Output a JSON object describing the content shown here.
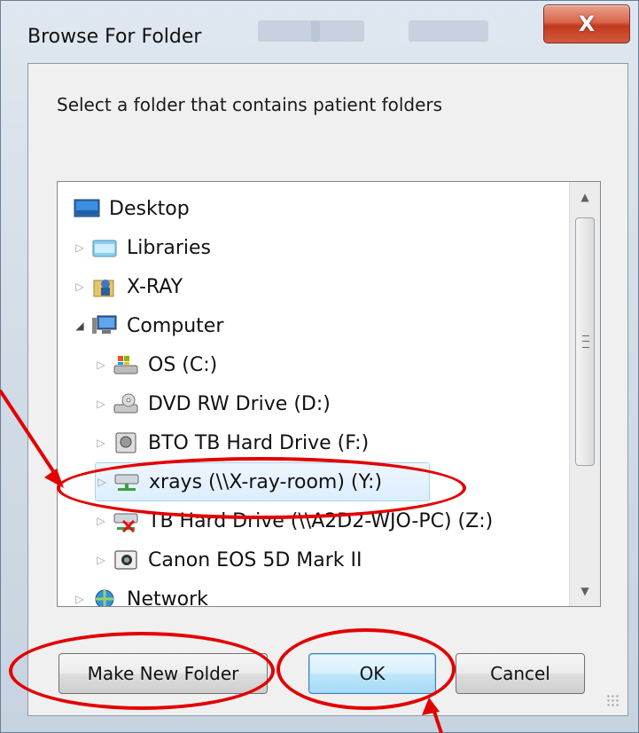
{
  "window": {
    "title": "Browse For Folder",
    "close_glyph": "X"
  },
  "prompt": "Select a folder that contains patient folders",
  "tree": {
    "items": [
      {
        "label": "Desktop",
        "icon": "desktop-icon",
        "expander": ""
      },
      {
        "label": "Libraries",
        "icon": "libraries-icon",
        "expander": "▷"
      },
      {
        "label": "X-RAY",
        "icon": "user-folder-icon",
        "expander": "▷"
      },
      {
        "label": "Computer",
        "icon": "computer-icon",
        "expander": "◢"
      },
      {
        "label": "OS (C:)",
        "icon": "os-drive-icon",
        "expander": "▷"
      },
      {
        "label": "DVD RW Drive (D:)",
        "icon": "dvd-drive-icon",
        "expander": "▷"
      },
      {
        "label": "BTO TB Hard Drive (F:)",
        "icon": "hard-drive-icon",
        "expander": "▷"
      },
      {
        "label": "xrays (\\\\X-ray-room) (Y:)",
        "icon": "network-drive-icon",
        "expander": "▷",
        "selected": true
      },
      {
        "label": "TB Hard Drive (\\\\A2D2-WJO-PC) (Z:)",
        "icon": "disconnected-drive-icon",
        "expander": "▷"
      },
      {
        "label": "Canon EOS 5D Mark II",
        "icon": "camera-icon",
        "expander": "▷"
      },
      {
        "label": "Network",
        "icon": "network-icon",
        "expander": "▷"
      }
    ]
  },
  "buttons": {
    "make_new_folder": "Make New Folder",
    "ok": "OK",
    "cancel": "Cancel"
  },
  "colors": {
    "annotation": "#e30000",
    "selection_border": "#a9d3f6",
    "default_button_border": "#3c7fb1"
  }
}
